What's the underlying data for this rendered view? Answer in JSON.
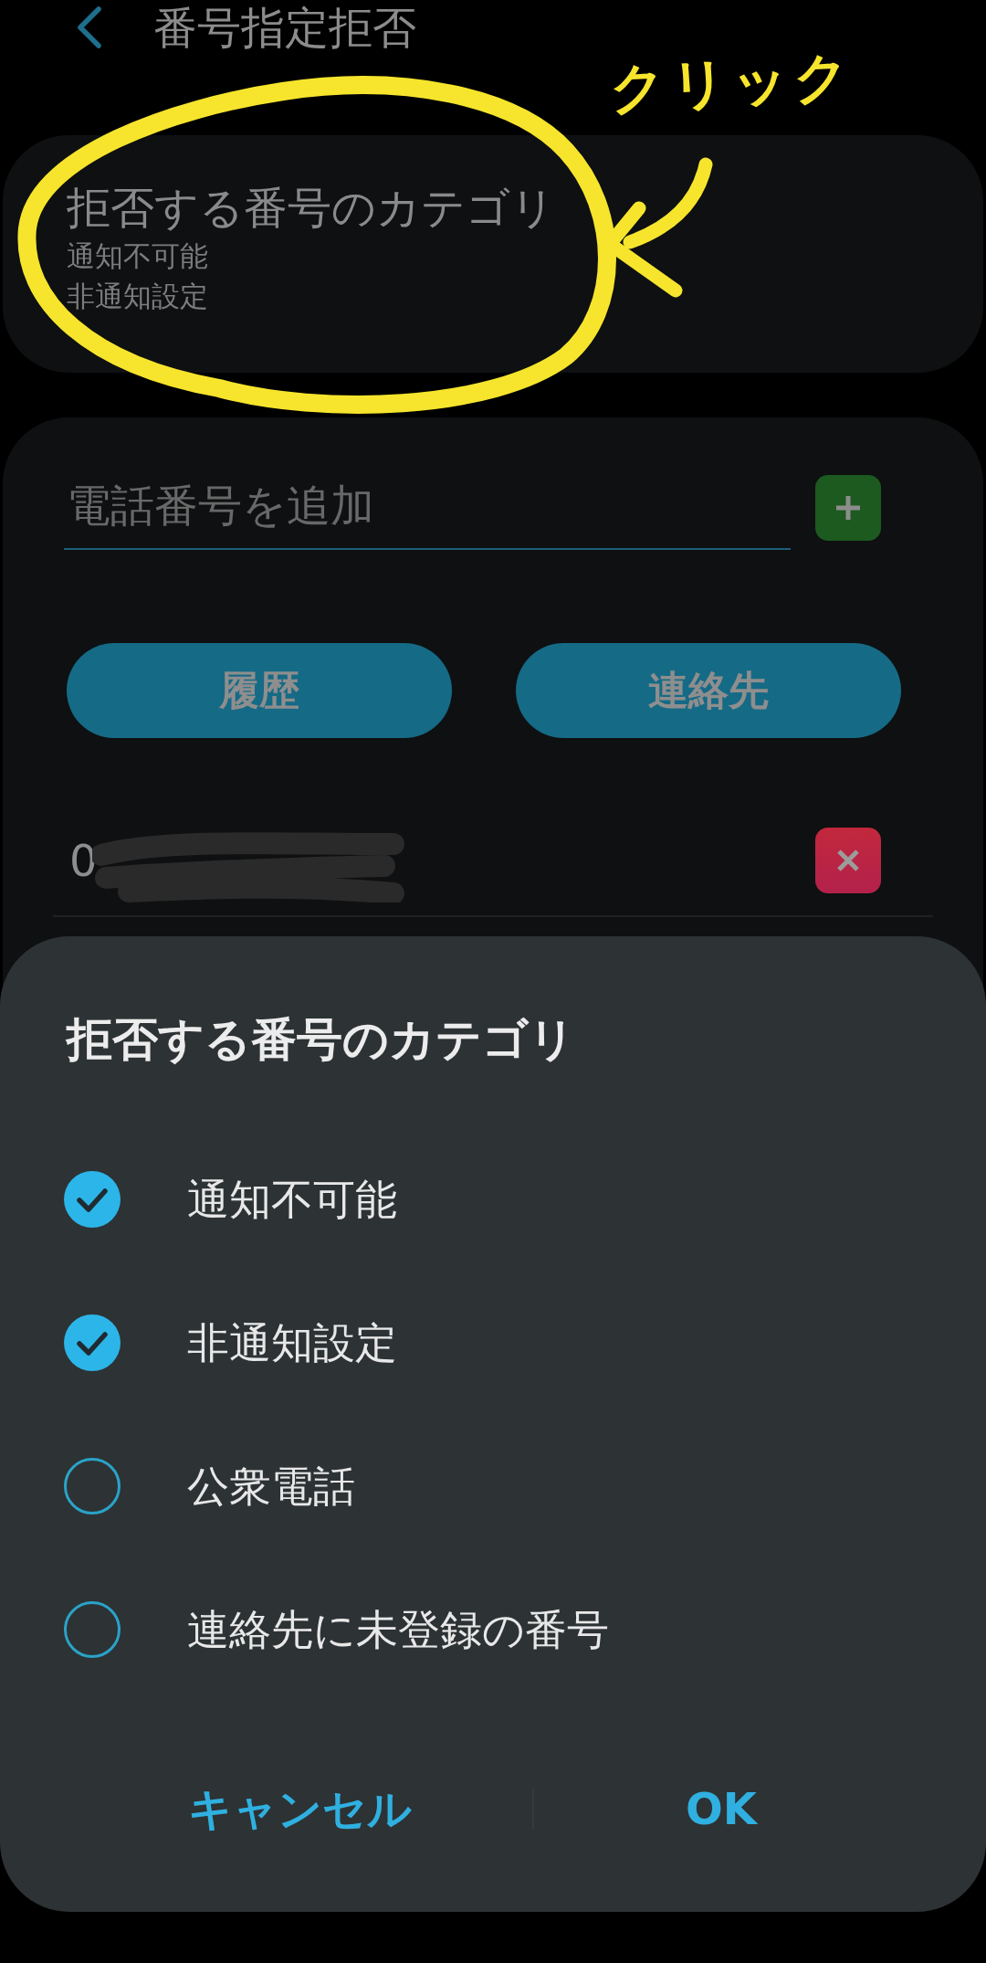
{
  "header": {
    "title": "番号指定拒否"
  },
  "category_card": {
    "title": "拒否する番号のカテゴリ",
    "summary": [
      "通知不可能",
      "非通知設定"
    ]
  },
  "add_number": {
    "placeholder": "電話番号を追加"
  },
  "source_buttons": [
    "履歴",
    "連絡先"
  ],
  "blocked_numbers": [
    {
      "number": "0"
    }
  ],
  "dialog": {
    "title": "拒否する番号のカテゴリ",
    "options": [
      {
        "label": "通知不可能",
        "checked": true
      },
      {
        "label": "非通知設定",
        "checked": true
      },
      {
        "label": "公衆電話",
        "checked": false
      },
      {
        "label": "連絡先に未登録の番号",
        "checked": false
      }
    ],
    "buttons": [
      "キャンセル",
      "OK"
    ]
  },
  "annotation": {
    "text": "クリック"
  }
}
